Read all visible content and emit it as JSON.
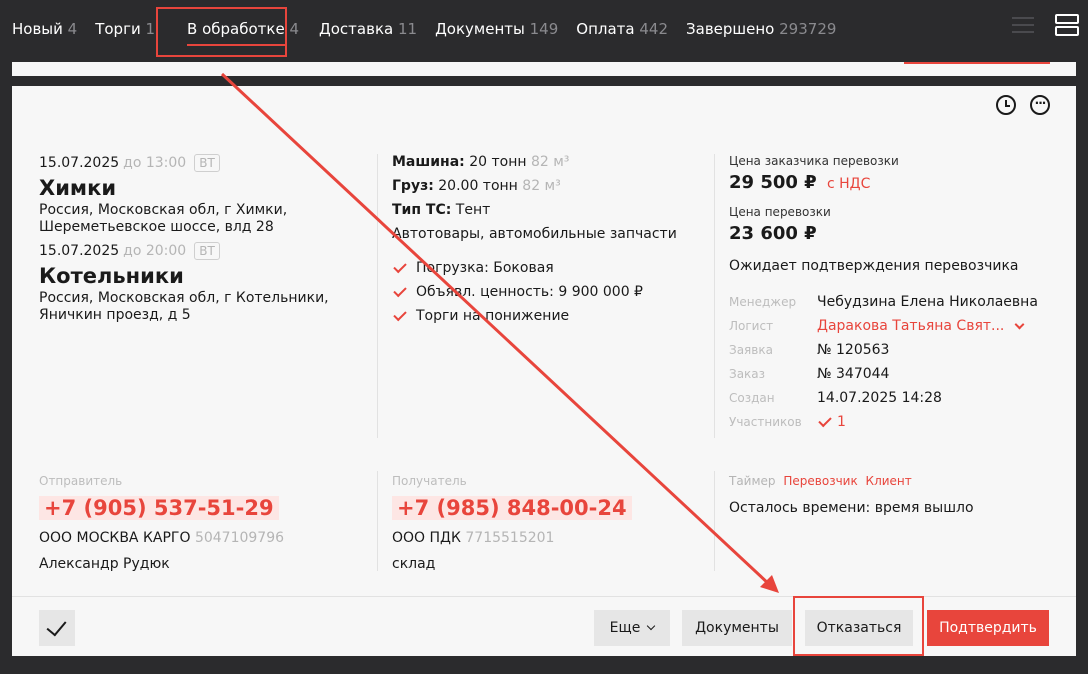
{
  "tabs": [
    {
      "label": "Новый",
      "count": "4"
    },
    {
      "label": "Торги",
      "count": "1"
    },
    {
      "label": "В обработке",
      "count": "4"
    },
    {
      "label": "Доставка",
      "count": "11"
    },
    {
      "label": "Документы",
      "count": "149"
    },
    {
      "label": "Оплата",
      "count": "442"
    },
    {
      "label": "Завершено",
      "count": "293729"
    }
  ],
  "colors": {
    "accent": "#e8453c",
    "dark_bg": "#2b2b2d"
  },
  "icons": {
    "view_list": "list-view-icon",
    "view_rows": "rows-view-icon",
    "history": "clock-icon",
    "chat": "chat-icon"
  },
  "route": {
    "load": {
      "date": "15.07.2025",
      "time": "до 13:00",
      "badge": "ВТ",
      "city": "Химки",
      "address": "Россия, Московская обл, г Химки, Шереметьевское шоссе, влд 28"
    },
    "unload": {
      "date": "15.07.2025",
      "time": "до 20:00",
      "badge": "ВТ",
      "city": "Котельники",
      "address": "Россия, Московская обл, г Котельники, Яничкин проезд, д 5"
    }
  },
  "cargo": {
    "vehicle_label": "Машина:",
    "vehicle_value": "20 тонн",
    "vehicle_volume": "82 м³",
    "cargo_label": "Груз:",
    "cargo_value": "20.00 тонн",
    "cargo_volume": "82 м³",
    "type_label": "Тип ТС:",
    "type_value": "Тент",
    "goods": "Автотовары, автомобильные запчасти",
    "checks": [
      "Погрузка: Боковая",
      "Объявл. ценность: 9 900 000 ₽",
      "Торги на понижение"
    ]
  },
  "pricing": {
    "customer_label": "Цена заказчика перевозки",
    "customer_value": "29 500 ₽",
    "vat": "с НДС",
    "price_label": "Цена перевозки",
    "price_value": "23 600 ₽",
    "status": "Ожидает подтверждения перевозчика"
  },
  "details": {
    "manager_k": "Менеджер",
    "manager_v": "Чебудзина Елена Николаевна",
    "logist_k": "Логист",
    "logist_v": "Даракова Татьяна Свят...",
    "request_k": "Заявка",
    "request_v": "№ 120563",
    "order_k": "Заказ",
    "order_v": "№ 347044",
    "created_k": "Создан",
    "created_v": "14.07.2025 14:28",
    "participants_k": "Участников",
    "participants_v": "1"
  },
  "sender": {
    "label": "Отправитель",
    "phone": "+7 (905) 537-51-29",
    "company": "ООО МОСКВА КАРГО",
    "inn": "5047109796",
    "person": "Александр Рудюк"
  },
  "receiver": {
    "label": "Получатель",
    "phone": "+7 (985) 848-00-24",
    "company": "ООО ПДК",
    "inn": "7715515201",
    "person": "склад"
  },
  "timer": {
    "label": "Таймер",
    "carrier": "Перевозчик",
    "client": "Клиент",
    "text": "Осталось времени: время вышло"
  },
  "actions": {
    "more": "Еще",
    "documents": "Документы",
    "refuse": "Отказаться",
    "confirm": "Подтвердить"
  }
}
